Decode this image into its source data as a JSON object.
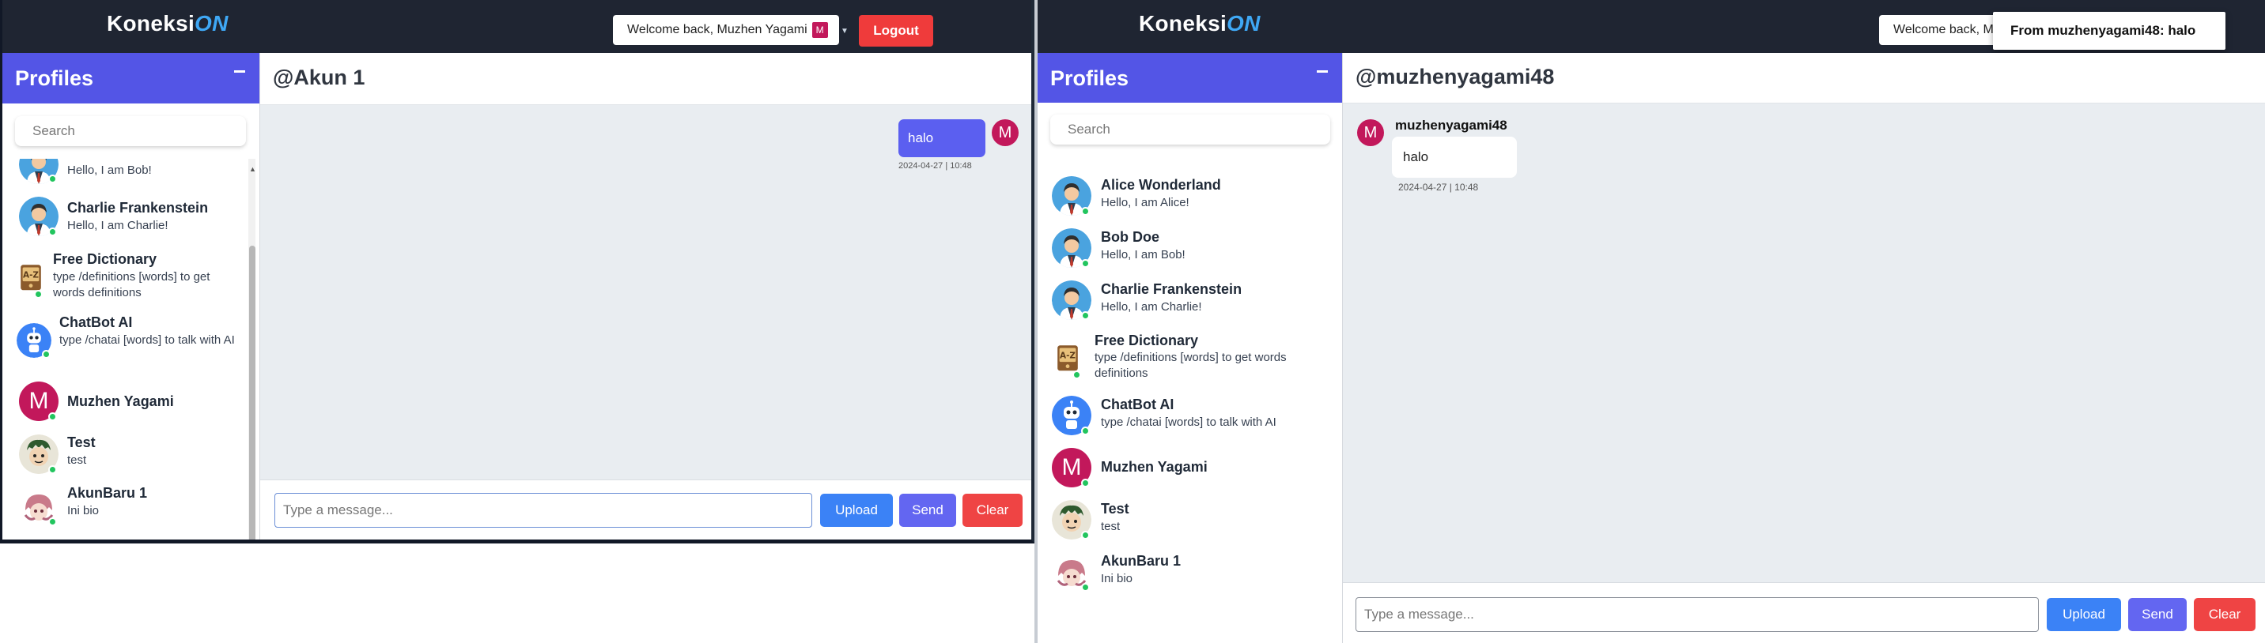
{
  "brand": {
    "koneksi": "Koneksi",
    "on": "ON"
  },
  "left_window": {
    "welcome": "Welcome back, Muzhen Yagami",
    "welcome_badge": "M",
    "logout_label": "Logout",
    "sidebar_title": "Profiles",
    "search_placeholder": "Search",
    "profiles": [
      {
        "name": "",
        "bio": "Hello, I am Bob!"
      },
      {
        "name": "Charlie Frankenstein",
        "bio": "Hello, I am Charlie!"
      },
      {
        "name": "Free Dictionary",
        "bio": "type /definitions [words] to get words definitions"
      },
      {
        "name": "ChatBot AI",
        "bio": "type /chatai [words] to talk with AI"
      },
      {
        "name": "Muzhen Yagami",
        "bio": ""
      },
      {
        "name": "Test",
        "bio": "test"
      },
      {
        "name": "AkunBaru 1",
        "bio": "Ini bio"
      }
    ],
    "chat_title": "@Akun 1",
    "message": {
      "text": "halo",
      "time": "2024-04-27 | 10:48",
      "avatar_letter": "M"
    },
    "input_placeholder": "Type a message...",
    "upload_label": "Upload",
    "send_label": "Send",
    "clear_label": "Clear"
  },
  "right_window": {
    "welcome": "Welcome back, Muzhen Yagami",
    "toast": "From muzhenyagami48: halo",
    "sidebar_title": "Profiles",
    "search_placeholder": "Search",
    "profiles": [
      {
        "name": "Alice Wonderland",
        "bio": "Hello, I am Alice!"
      },
      {
        "name": "Bob Doe",
        "bio": "Hello, I am Bob!"
      },
      {
        "name": "Charlie Frankenstein",
        "bio": "Hello, I am Charlie!"
      },
      {
        "name": "Free Dictionary",
        "bio": "type /definitions [words] to get words definitions"
      },
      {
        "name": "ChatBot AI",
        "bio": "type /chatai [words] to talk with AI"
      },
      {
        "name": "Muzhen Yagami",
        "bio": ""
      },
      {
        "name": "Test",
        "bio": "test"
      },
      {
        "name": "AkunBaru 1",
        "bio": "Ini bio"
      }
    ],
    "chat_title": "@muzhenyagami48",
    "message": {
      "sender": "muzhenyagami48",
      "text": "halo",
      "time": "2024-04-27 | 10:48",
      "avatar_letter": "M"
    },
    "input_placeholder": "Type a message...",
    "upload_label": "Upload",
    "send_label": "Send",
    "clear_label": "Clear"
  },
  "icons": {
    "person": "person-avatar-icon",
    "dictionary": "dictionary-book-icon",
    "chatbot": "robot-icon",
    "letter": "letter-avatar-icon",
    "online": "online-status-icon"
  },
  "colors": {
    "accent": "#5355e6",
    "topbar": "#1f2532",
    "brand_on": "#3fa8f5",
    "logout": "#ef3b3b",
    "upload": "#3b82f6",
    "send": "#6366f1",
    "clear": "#ef4444",
    "online": "#22c55e",
    "letter_avatar": "#c2185b"
  }
}
